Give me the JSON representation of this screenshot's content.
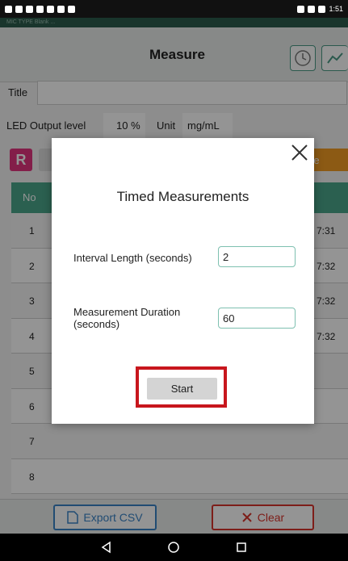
{
  "status_bar": {
    "time": "1:51"
  },
  "subbar": {
    "text": "MIC TYPE Blank ..."
  },
  "header": {
    "title": "Measure",
    "timer_icon": "clock-icon",
    "chart_icon": "line-chart-icon"
  },
  "form": {
    "title_label": "Title",
    "title_value": "",
    "led_label": "LED Output level",
    "led_value": "10 %",
    "unit_label": "Unit",
    "unit_value": "mg/mL"
  },
  "action_row": {
    "r_label": "R",
    "orange_label": "re"
  },
  "table": {
    "header_no": "No",
    "rows": [
      {
        "no": "1",
        "time": "7:31"
      },
      {
        "no": "2",
        "time": "7:32"
      },
      {
        "no": "3",
        "time": "7:32"
      },
      {
        "no": "4",
        "time": "7:32"
      },
      {
        "no": "5",
        "time": ""
      },
      {
        "no": "6",
        "time": ""
      },
      {
        "no": "7",
        "time": ""
      },
      {
        "no": "8",
        "time": ""
      }
    ]
  },
  "bottom": {
    "export_label": "Export CSV",
    "clear_label": "Clear"
  },
  "dialog": {
    "title": "Timed Measurements",
    "interval_label": "Interval Length (seconds)",
    "interval_value": "2",
    "duration_label": "Measurement Duration (seconds)",
    "duration_value": "60",
    "start_label": "Start"
  },
  "colors": {
    "accent": "#4aa58b",
    "r_button": "#e2347e",
    "orange_button": "#f29b24",
    "export": "#3a83c7",
    "clear": "#d8342c",
    "highlight": "#c8161d"
  }
}
